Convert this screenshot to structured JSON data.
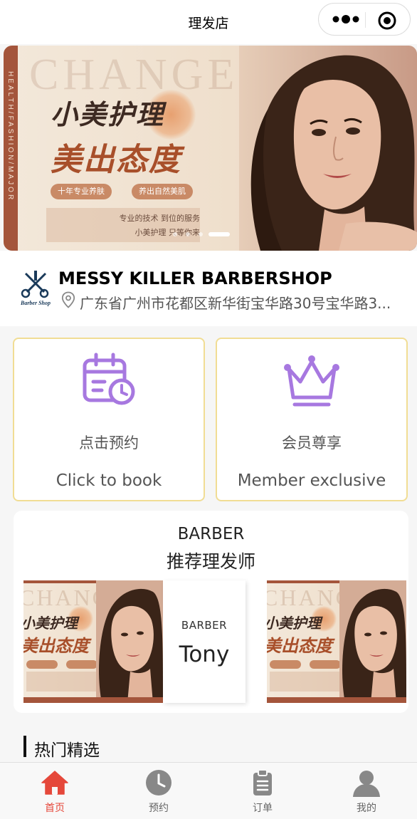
{
  "nav": {
    "title": "理发店",
    "more_icon": "more-dots-icon",
    "close_icon": "target-icon"
  },
  "banner": {
    "side_text": "HEALTH/FASHION/MAJOR",
    "ghost_text": "CHANGE SHAPE",
    "headline1": "小美护理",
    "headline2": "美出态度",
    "tags": [
      "十年专业养肤",
      "养出自然美肌"
    ],
    "sub1": "专业的技术 到位的服务",
    "sub2": "小美护理 只等你来",
    "active_index": 4,
    "indicator_count": 4
  },
  "shop": {
    "logo_text": "Barber Shop",
    "name": "MESSY KILLER BARBERSHOP",
    "address": "广东省广州市花都区新华街宝华路30号宝华路3..."
  },
  "cards": [
    {
      "cn": "点击预约",
      "en": "Click to book",
      "icon": "calendar-clock-icon"
    },
    {
      "cn": "会员尊享",
      "en": "Member exclusive",
      "icon": "crown-icon"
    }
  ],
  "barber_section": {
    "subtitle": "BARBER",
    "title": "推荐理发师",
    "barber": {
      "role": "BARBER",
      "name": "Tony"
    }
  },
  "hot": {
    "title": "热门精选"
  },
  "tabs": [
    {
      "label": "首页",
      "icon": "home-icon",
      "active": true
    },
    {
      "label": "预约",
      "icon": "clock-icon",
      "active": false
    },
    {
      "label": "订单",
      "icon": "clipboard-icon",
      "active": false
    },
    {
      "label": "我的",
      "icon": "user-icon",
      "active": false
    }
  ],
  "colors": {
    "accent": "#e5483b",
    "icon_purple": "#a778e0",
    "card_border": "#f1dd94",
    "promo_brown": "#a4553b"
  }
}
